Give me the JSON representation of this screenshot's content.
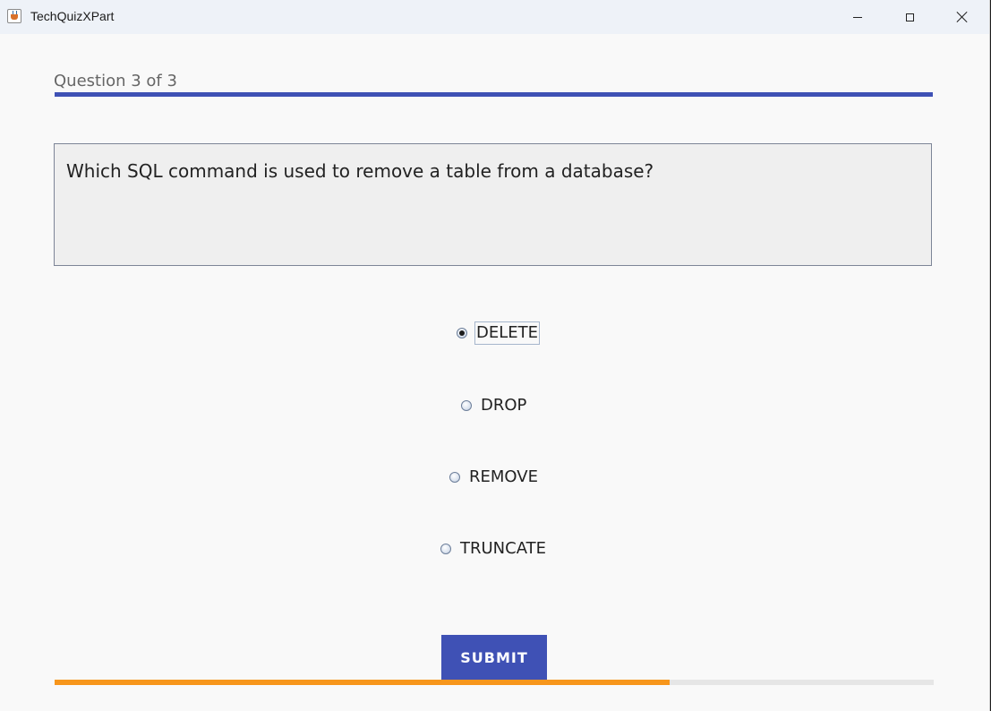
{
  "window": {
    "title": "TechQuizXPart"
  },
  "quiz": {
    "counter": "Question 3 of 3",
    "question": "Which SQL command is used to remove a table from a database?",
    "options": [
      {
        "label": "DELETE",
        "selected": true
      },
      {
        "label": "DROP",
        "selected": false
      },
      {
        "label": "REMOVE",
        "selected": false
      },
      {
        "label": "TRUNCATE",
        "selected": false
      }
    ],
    "submit_label": "SUBMIT",
    "progress_fraction": 0.7
  },
  "colors": {
    "accent": "#3f51b5",
    "progress": "#f7961c"
  }
}
